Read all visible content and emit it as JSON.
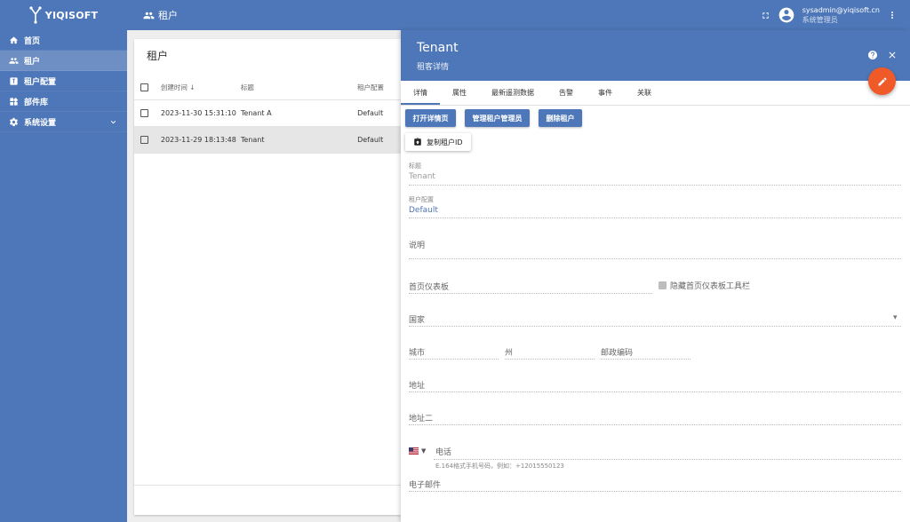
{
  "brand": {
    "name": "YIQISOFT"
  },
  "sidebar": {
    "items": [
      {
        "label": "首页",
        "icon": "home-icon"
      },
      {
        "label": "租户",
        "icon": "tenants-icon"
      },
      {
        "label": "租户配置",
        "icon": "tenant-profile-icon"
      },
      {
        "label": "部件库",
        "icon": "widgets-icon"
      },
      {
        "label": "系统设置",
        "icon": "settings-icon"
      }
    ]
  },
  "topbar": {
    "title": "租户",
    "user_email": "sysadmin@yiqisoft.cn",
    "user_role": "系统管理员"
  },
  "table": {
    "title": "租户",
    "columns": [
      "创建时间",
      "标题",
      "租户配置"
    ],
    "rows": [
      {
        "created": "2023-11-30 15:31:10",
        "title": "Tenant A",
        "profile": "Default"
      },
      {
        "created": "2023-11-29 18:13:48",
        "title": "Tenant",
        "profile": "Default"
      }
    ]
  },
  "detail": {
    "title": "Tenant",
    "subtitle": "租客详情",
    "tabs": [
      "详情",
      "属性",
      "最新遥测数据",
      "告警",
      "事件",
      "关联"
    ],
    "buttons": {
      "open_details": "打开详情页",
      "manage_admins": "管理租户管理员",
      "delete": "删除租户",
      "copy_id": "复制租户ID"
    },
    "fields": {
      "title_label": "标题",
      "title_value": "Tenant",
      "profile_label": "租户配置",
      "profile_value": "Default",
      "description": "说明",
      "home_dashboard": "首页仪表板",
      "hide_toolbar": "隐藏首页仪表板工具栏",
      "country": "国家",
      "city": "城市",
      "state": "州",
      "zip": "邮政编码",
      "address": "地址",
      "address2": "地址二",
      "phone": "电话",
      "phone_hint": "E.164格式手机号码，例如：+12015550123",
      "email": "电子邮件"
    }
  },
  "colors": {
    "primary": "#4d77b8",
    "accent": "#f05a28"
  }
}
